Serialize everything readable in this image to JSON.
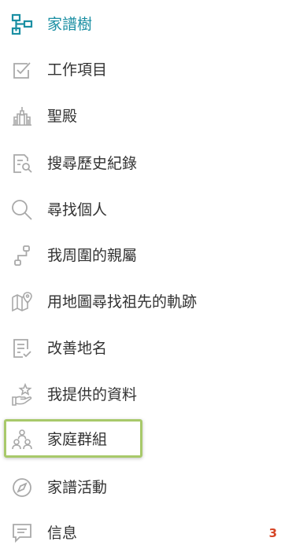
{
  "menu": {
    "items": [
      {
        "label": "家譜樹",
        "icon": "family-tree-icon",
        "active": true
      },
      {
        "label": "工作項目",
        "icon": "checkbox-icon"
      },
      {
        "label": "聖殿",
        "icon": "temple-icon"
      },
      {
        "label": "搜尋歷史紀錄",
        "icon": "document-search-icon"
      },
      {
        "label": "尋找個人",
        "icon": "search-icon"
      },
      {
        "label": "我周圍的親屬",
        "icon": "relatives-nearby-icon"
      },
      {
        "label": "用地圖尋找祖先的軌跡",
        "icon": "map-pin-icon"
      },
      {
        "label": "改善地名",
        "icon": "document-check-icon"
      },
      {
        "label": "我提供的資料",
        "icon": "hand-star-icon"
      },
      {
        "label": "家庭群組",
        "icon": "family-group-icon",
        "highlighted": true
      },
      {
        "label": "家譜活動",
        "icon": "compass-icon"
      },
      {
        "label": "信息",
        "icon": "message-icon",
        "badge": "3"
      }
    ]
  },
  "colors": {
    "accent": "#1b8fa3",
    "icon_gray": "#a9a9a9",
    "text": "#333333",
    "badge": "#d64526",
    "highlight_border": "#a8c96a"
  }
}
